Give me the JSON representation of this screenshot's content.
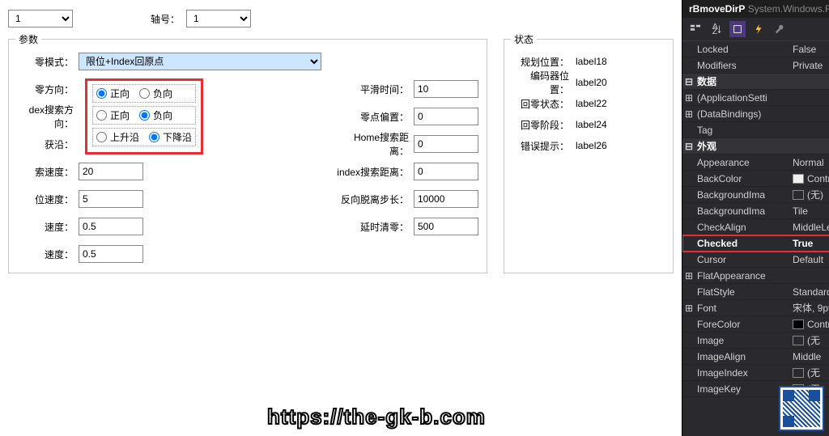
{
  "header": {
    "control_name": "rBmoveDirP",
    "control_ns": "System.Windows.Forms"
  },
  "top": {
    "combo1_value": "1",
    "axis_label": "轴号：",
    "axis_value": "1"
  },
  "params": {
    "group_title": "参数",
    "mode_label": "零模式：",
    "mode_value": "限位+Index回原点",
    "dir_label": "零方向：",
    "idx_dir_label": "dex搜索方向：",
    "edge_label": "获沿：",
    "speed_label": "索速度：",
    "speed_val": "20",
    "pos_speed_label": "位速度：",
    "pos_speed_val": "5",
    "vel_label": "速度：",
    "vel_val": "0.5",
    "vel2_label": "速度：",
    "vel2_val": "0.5",
    "radios": {
      "dir_pos": "正向",
      "dir_neg": "负向",
      "idx_pos": "正向",
      "idx_neg": "负向",
      "edge_rise": "上升沿",
      "edge_fall": "下降沿"
    },
    "smooth_label": "平滑时间：",
    "smooth_val": "10",
    "offset_label": "零点偏置：",
    "offset_val": "0",
    "home_dist_label": "Home搜索距离：",
    "home_dist_val": "0",
    "index_dist_label": "index搜索距离：",
    "index_dist_val": "0",
    "back_step_label": "反向脱离步长：",
    "back_step_val": "10000",
    "delay_label": "延时清零：",
    "delay_val": "500"
  },
  "status": {
    "group_title": "状态",
    "plan_pos_label": "规划位置：",
    "plan_pos_val": "label18",
    "enc_pos_label": "编码器位置：",
    "enc_pos_val": "label20",
    "ret_state_label": "回零状态：",
    "ret_state_val": "label22",
    "ret_stage_label": "回零阶段：",
    "ret_stage_val": "label24",
    "err_label": "错误提示：",
    "err_val": "label26"
  },
  "props": [
    {
      "exp": "",
      "name": "Locked",
      "val": "False"
    },
    {
      "exp": "",
      "name": "Modifiers",
      "val": "Private"
    },
    {
      "cat": true,
      "exp": "⊟",
      "name": "数据"
    },
    {
      "exp": "⊞",
      "name": "(ApplicationSetti",
      "val": ""
    },
    {
      "exp": "⊞",
      "name": "(DataBindings)",
      "val": ""
    },
    {
      "exp": "",
      "name": "Tag",
      "val": ""
    },
    {
      "cat": true,
      "exp": "⊟",
      "name": "外观"
    },
    {
      "exp": "",
      "name": "Appearance",
      "val": "Normal"
    },
    {
      "exp": "",
      "name": "BackColor",
      "val": "Control",
      "swatch": "#f0f0f0"
    },
    {
      "exp": "",
      "name": "BackgroundIma",
      "val": "(无)",
      "swatch": ""
    },
    {
      "exp": "",
      "name": "BackgroundIma",
      "val": "Tile"
    },
    {
      "exp": "",
      "name": "CheckAlign",
      "val": "MiddleLeft"
    },
    {
      "hl": true,
      "exp": "",
      "name": "Checked",
      "val": "True"
    },
    {
      "exp": "",
      "name": "Cursor",
      "val": "Default"
    },
    {
      "exp": "⊞",
      "name": "FlatAppearance",
      "val": ""
    },
    {
      "exp": "",
      "name": "FlatStyle",
      "val": "Standard"
    },
    {
      "exp": "⊞",
      "name": "Font",
      "val": "宋体, 9pt"
    },
    {
      "exp": "",
      "name": "ForeColor",
      "val": "ControlText",
      "swatch": "#000"
    },
    {
      "exp": "",
      "name": "Image",
      "val": "(无",
      "swatch": ""
    },
    {
      "exp": "",
      "name": "ImageAlign",
      "val": "Middle"
    },
    {
      "exp": "",
      "name": "ImageIndex",
      "val": "(无",
      "swatch": ""
    },
    {
      "exp": "",
      "name": "ImageKey",
      "val": "(无",
      "swatch": ""
    }
  ],
  "watermark": "https://the-gk-b.com"
}
